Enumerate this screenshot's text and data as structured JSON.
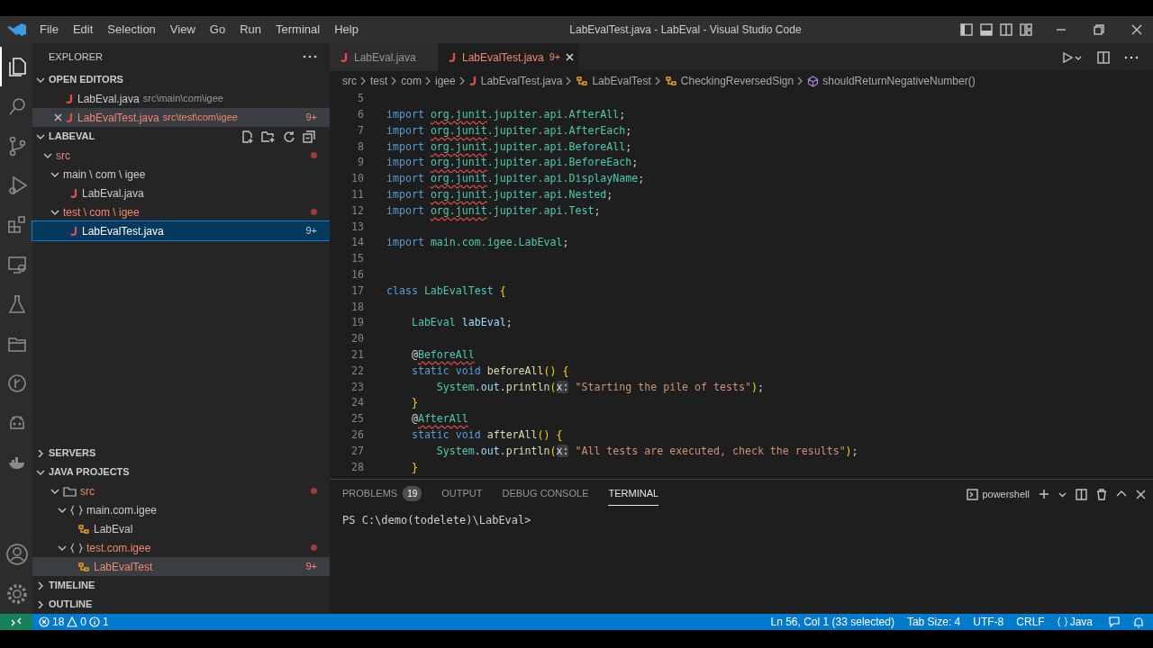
{
  "window": {
    "title": "LabEvalTest.java - LabEval - Visual Studio Code"
  },
  "menu": [
    "File",
    "Edit",
    "Selection",
    "View",
    "Go",
    "Run",
    "Terminal",
    "Help"
  ],
  "activity_bar": {
    "items": [
      {
        "selected": true
      },
      {
        "selected": false
      },
      {
        "selected": false
      },
      {
        "selected": false
      },
      {
        "selected": false
      },
      {
        "selected": false
      },
      {
        "selected": false
      },
      {
        "selected": false
      },
      {
        "selected": false
      },
      {
        "selected": false
      },
      {
        "selected": false
      }
    ]
  },
  "sidebar": {
    "title": "EXPLORER",
    "open_editors": {
      "title": "OPEN EDITORS",
      "expanded": true,
      "items": [
        {
          "label": "LabEval.java",
          "path": "src\\main\\com\\igee",
          "error": false,
          "hovered": false
        },
        {
          "label": "LabEvalTest.java",
          "path": "src\\test\\com\\igee",
          "error": true,
          "hovered": true,
          "badge": "9+"
        }
      ]
    },
    "folder": {
      "title": "LABEVAL",
      "expanded": true,
      "tree": [
        {
          "label": "src",
          "expanded": true,
          "error": true,
          "selected": false,
          "children": [
            {
              "label": "main \\ com \\ igee",
              "expanded": true,
              "error": false,
              "selected": false,
              "children": [
                {
                  "label": "LabEval.java",
                  "kind": "java",
                  "error": false,
                  "selected": false
                }
              ]
            },
            {
              "label": "test \\ com \\ igee",
              "expanded": true,
              "error": true,
              "selected": false,
              "children": [
                {
                  "label": "LabEvalTest.java",
                  "kind": "java",
                  "error": true,
                  "selected": true,
                  "badge": "9+"
                }
              ]
            }
          ]
        }
      ]
    },
    "servers": {
      "title": "SERVERS",
      "expanded": false
    },
    "java_projects": {
      "title": "JAVA PROJECTS",
      "expanded": true,
      "tree": [
        {
          "label": "src",
          "kind": "folder",
          "expanded": true,
          "error": true,
          "hovered": false,
          "children": [
            {
              "label": "main.com.igee",
              "kind": "package",
              "expanded": true,
              "error": false,
              "hovered": false,
              "children": [
                {
                  "label": "LabEval",
                  "kind": "class",
                  "error": false,
                  "hovered": false
                }
              ]
            },
            {
              "label": "test.com.igee",
              "kind": "package",
              "expanded": true,
              "error": true,
              "hovered": false,
              "children": [
                {
                  "label": "LabEvalTest",
                  "kind": "class",
                  "error": true,
                  "hovered": true,
                  "badge": "9+"
                }
              ]
            }
          ]
        }
      ]
    },
    "timeline": {
      "title": "TIMELINE",
      "expanded": false
    },
    "outline": {
      "title": "OUTLINE",
      "expanded": false
    }
  },
  "editor": {
    "tabs": [
      {
        "label": "LabEval.java",
        "selected": false,
        "error": false
      },
      {
        "label": "LabEvalTest.java",
        "selected": true,
        "error": true,
        "badge": "9+"
      }
    ],
    "breadcrumbs": [
      {
        "label": "src",
        "kind": "folder"
      },
      {
        "label": "test",
        "kind": "folder"
      },
      {
        "label": "com",
        "kind": "folder"
      },
      {
        "label": "igee",
        "kind": "folder"
      },
      {
        "label": "LabEvalTest.java",
        "kind": "file"
      },
      {
        "label": "LabEvalTest",
        "kind": "class"
      },
      {
        "label": "CheckingReversedSign",
        "kind": "class"
      },
      {
        "label": "shouldReturnNegativeNumber()",
        "kind": "method"
      }
    ],
    "lines": [
      {
        "number": "5"
      },
      {
        "number": "6",
        "tokens": [
          {
            "text": "import ",
            "kind": "keyword"
          },
          {
            "text": "org.junit",
            "kind": "type",
            "error": true
          },
          {
            "text": ".jupiter.api.AfterAll",
            "kind": "type"
          },
          {
            "text": ";"
          }
        ]
      },
      {
        "number": "7",
        "tokens": [
          {
            "text": "import ",
            "kind": "keyword"
          },
          {
            "text": "org.junit",
            "kind": "type",
            "error": true
          },
          {
            "text": ".jupiter.api.AfterEach",
            "kind": "type"
          },
          {
            "text": ";"
          }
        ]
      },
      {
        "number": "8",
        "tokens": [
          {
            "text": "import ",
            "kind": "keyword"
          },
          {
            "text": "org.junit",
            "kind": "type",
            "error": true
          },
          {
            "text": ".jupiter.api.BeforeAll",
            "kind": "type"
          },
          {
            "text": ";"
          }
        ]
      },
      {
        "number": "9",
        "tokens": [
          {
            "text": "import ",
            "kind": "keyword"
          },
          {
            "text": "org.junit",
            "kind": "type",
            "error": true
          },
          {
            "text": ".jupiter.api.BeforeEach",
            "kind": "type"
          },
          {
            "text": ";"
          }
        ]
      },
      {
        "number": "10",
        "tokens": [
          {
            "text": "import ",
            "kind": "keyword"
          },
          {
            "text": "org.junit",
            "kind": "type",
            "error": true
          },
          {
            "text": ".jupiter.api.DisplayName",
            "kind": "type"
          },
          {
            "text": ";"
          }
        ]
      },
      {
        "number": "11",
        "tokens": [
          {
            "text": "import ",
            "kind": "keyword"
          },
          {
            "text": "org.junit",
            "kind": "type",
            "error": true
          },
          {
            "text": ".jupiter.api.Nested",
            "kind": "type"
          },
          {
            "text": ";"
          }
        ]
      },
      {
        "number": "12",
        "tokens": [
          {
            "text": "import ",
            "kind": "keyword"
          },
          {
            "text": "org.junit",
            "kind": "type",
            "error": true
          },
          {
            "text": ".jupiter.api.Test",
            "kind": "type"
          },
          {
            "text": ";"
          }
        ]
      },
      {
        "number": "13"
      },
      {
        "number": "14",
        "tokens": [
          {
            "text": "import ",
            "kind": "keyword"
          },
          {
            "text": "main.com.igee.LabEval",
            "kind": "type"
          },
          {
            "text": ";"
          }
        ]
      },
      {
        "number": "15"
      },
      {
        "number": "16"
      },
      {
        "number": "17",
        "tokens": [
          {
            "text": "class ",
            "kind": "keyword"
          },
          {
            "text": "LabEvalTest ",
            "kind": "type"
          },
          {
            "text": "{",
            "kind": "bracket"
          }
        ]
      },
      {
        "number": "18"
      },
      {
        "number": "19",
        "tokens": [
          {
            "text": "    LabEval ",
            "kind": "type"
          },
          {
            "text": "labEval",
            "kind": "variable"
          },
          {
            "text": ";"
          }
        ]
      },
      {
        "number": "20"
      },
      {
        "number": "21",
        "tokens": [
          {
            "text": "    @"
          },
          {
            "text": "BeforeAll",
            "kind": "type",
            "error": true
          }
        ]
      },
      {
        "number": "22",
        "tokens": [
          {
            "text": "    static void ",
            "kind": "keyword"
          },
          {
            "text": "beforeAll",
            "kind": "function"
          },
          {
            "text": "() {",
            "kind": "bracket"
          }
        ]
      },
      {
        "number": "23",
        "tokens": [
          {
            "text": "        System",
            "kind": "type"
          },
          {
            "text": "."
          },
          {
            "text": "out",
            "kind": "variable"
          },
          {
            "text": "."
          },
          {
            "text": "println",
            "kind": "function"
          },
          {
            "text": "(",
            "kind": "bracket"
          },
          {
            "text": "x:",
            "kind": "hint"
          },
          {
            "text": " \"Starting the pile of tests\"",
            "kind": "string"
          },
          {
            "text": ")",
            "kind": "bracket"
          },
          {
            "text": ";"
          }
        ]
      },
      {
        "number": "24",
        "tokens": [
          {
            "text": "    }",
            "kind": "bracket"
          }
        ]
      },
      {
        "number": "25",
        "tokens": [
          {
            "text": "    @"
          },
          {
            "text": "AfterAll",
            "kind": "type",
            "error": true
          }
        ]
      },
      {
        "number": "26",
        "tokens": [
          {
            "text": "    static void ",
            "kind": "keyword"
          },
          {
            "text": "afterAll",
            "kind": "function"
          },
          {
            "text": "() {",
            "kind": "bracket"
          }
        ]
      },
      {
        "number": "27",
        "tokens": [
          {
            "text": "        System",
            "kind": "type"
          },
          {
            "text": "."
          },
          {
            "text": "out",
            "kind": "variable"
          },
          {
            "text": "."
          },
          {
            "text": "println",
            "kind": "function"
          },
          {
            "text": "(",
            "kind": "bracket"
          },
          {
            "text": "x:",
            "kind": "hint"
          },
          {
            "text": " \"All tests are executed, check the results\"",
            "kind": "string"
          },
          {
            "text": ")",
            "kind": "bracket"
          },
          {
            "text": ";"
          }
        ]
      },
      {
        "number": "28",
        "tokens": [
          {
            "text": "    }",
            "kind": "bracket"
          }
        ]
      }
    ]
  },
  "panel": {
    "tabs": [
      {
        "label": "PROBLEMS",
        "count": "19",
        "selected": false
      },
      {
        "label": "OUTPUT",
        "selected": false
      },
      {
        "label": "DEBUG CONSOLE",
        "selected": false
      },
      {
        "label": "TERMINAL",
        "selected": true
      }
    ],
    "shell": "powershell",
    "terminal_lines": [
      "PS C:\\demo(todelete)\\LabEval>"
    ]
  },
  "status_bar": {
    "errors": "18",
    "warnings": "0",
    "infos": "1",
    "items": [
      {
        "label": "Ln 56, Col 1 (33 selected)"
      },
      {
        "label": "Tab Size: 4"
      },
      {
        "label": "UTF-8"
      },
      {
        "label": "CRLF"
      },
      {
        "label": "Java",
        "kind": "language"
      }
    ]
  }
}
